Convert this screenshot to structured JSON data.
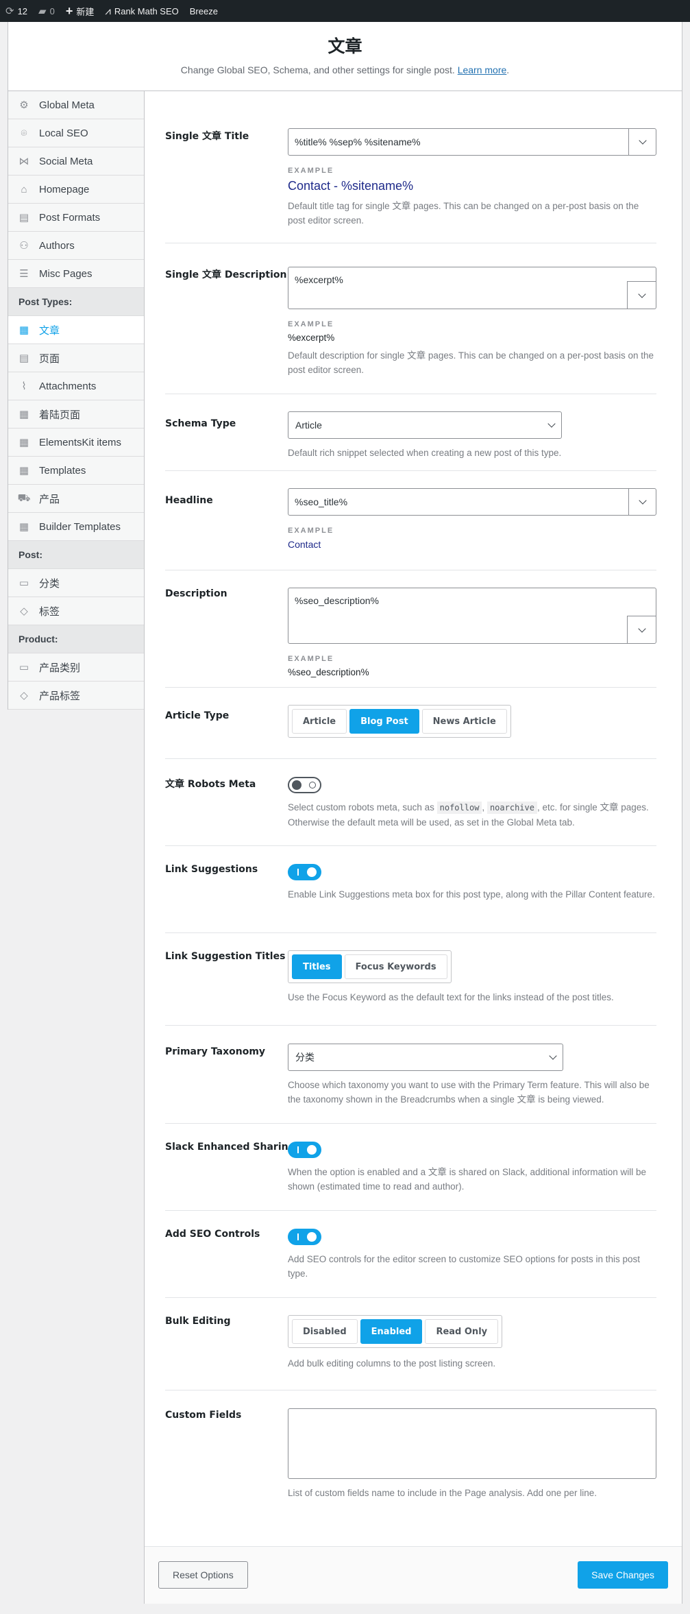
{
  "adminbar": {
    "items": [
      {
        "icon": "refresh-icon",
        "glyph": "⟳",
        "label": "12"
      },
      {
        "icon": "comment-icon",
        "glyph": "▰",
        "label": "0"
      },
      {
        "icon": "plus-icon",
        "glyph": "+",
        "label": "新建"
      },
      {
        "icon": "rankmath-icon",
        "glyph": "⩘",
        "label": "Rank Math SEO"
      },
      {
        "icon": "",
        "glyph": "",
        "label": "Breeze"
      }
    ]
  },
  "header": {
    "title": "文章",
    "subtitle": "Change Global SEO, Schema, and other settings for single post.",
    "learn_more": "Learn more"
  },
  "sidebar": {
    "items": [
      {
        "type": "item",
        "icon": "gear-icon",
        "glyph": "⚙",
        "label": "Global Meta"
      },
      {
        "type": "item",
        "icon": "location-pin-icon",
        "glyph": "⌾",
        "label": "Local SEO"
      },
      {
        "type": "item",
        "icon": "share-icon",
        "glyph": "⋈",
        "label": "Social Meta"
      },
      {
        "type": "item",
        "icon": "home-icon",
        "glyph": "⌂",
        "label": "Homepage"
      },
      {
        "type": "item",
        "icon": "document-icon",
        "glyph": "▤",
        "label": "Post Formats"
      },
      {
        "type": "item",
        "icon": "users-icon",
        "glyph": "⚇",
        "label": "Authors"
      },
      {
        "type": "item",
        "icon": "list-circle-icon",
        "glyph": "☰",
        "label": "Misc Pages"
      },
      {
        "type": "group",
        "label": "Post Types:"
      },
      {
        "type": "item",
        "icon": "post-icon",
        "glyph": "▦",
        "label": "文章",
        "active": true
      },
      {
        "type": "item",
        "icon": "page-icon",
        "glyph": "▤",
        "label": "页面"
      },
      {
        "type": "item",
        "icon": "paperclip-icon",
        "glyph": "⌇",
        "label": "Attachments"
      },
      {
        "type": "item",
        "icon": "post-icon",
        "glyph": "▦",
        "label": "着陆页面"
      },
      {
        "type": "item",
        "icon": "post-icon",
        "glyph": "▦",
        "label": "ElementsKit items"
      },
      {
        "type": "item",
        "icon": "post-icon",
        "glyph": "▦",
        "label": "Templates"
      },
      {
        "type": "item",
        "icon": "cart-icon",
        "glyph": "⛟",
        "label": "产品"
      },
      {
        "type": "item",
        "icon": "post-icon",
        "glyph": "▦",
        "label": "Builder Templates"
      },
      {
        "type": "group",
        "label": "Post:"
      },
      {
        "type": "item",
        "icon": "folder-icon",
        "glyph": "▭",
        "label": "分类"
      },
      {
        "type": "item",
        "icon": "tag-icon",
        "glyph": "◇",
        "label": "标签"
      },
      {
        "type": "group",
        "label": "Product:"
      },
      {
        "type": "item",
        "icon": "folder-icon",
        "glyph": "▭",
        "label": "产品类别"
      },
      {
        "type": "item",
        "icon": "tag-icon",
        "glyph": "◇",
        "label": "产品标签"
      }
    ]
  },
  "settings": {
    "example_label": "EXAMPLE",
    "single_title": {
      "label": "Single 文章 Title",
      "value": "%title% %sep% %sitename%",
      "example": "Contact - %sitename%",
      "desc": "Default title tag for single 文章 pages. This can be changed on a per-post basis on the post editor screen."
    },
    "single_description": {
      "label": "Single 文章 Description",
      "value": "%excerpt%",
      "example": "%excerpt%",
      "desc": "Default description for single 文章 pages. This can be changed on a per-post basis on the post editor screen."
    },
    "schema_type": {
      "label": "Schema Type",
      "value": "Article",
      "desc": "Default rich snippet selected when creating a new post of this type."
    },
    "headline": {
      "label": "Headline",
      "value": "%seo_title%",
      "example": "Contact"
    },
    "description": {
      "label": "Description",
      "value": "%seo_description%",
      "example": "%seo_description%"
    },
    "article_type": {
      "label": "Article Type",
      "options": [
        "Article",
        "Blog Post",
        "News Article"
      ],
      "selected": "Blog Post"
    },
    "robots_meta": {
      "label": "文章 Robots Meta",
      "enabled": false,
      "desc_before": "Select custom robots meta, such as",
      "code1": "nofollow",
      "sep": ",",
      "code2": "noarchive",
      "desc_after": ", etc. for single 文章 pages. Otherwise the default meta will be used, as set in the Global Meta tab."
    },
    "link_suggestions": {
      "label": "Link Suggestions",
      "enabled": true,
      "desc": "Enable Link Suggestions meta box for this post type, along with the Pillar Content feature."
    },
    "link_suggestion_titles": {
      "label": "Link Suggestion Titles",
      "options": [
        "Titles",
        "Focus Keywords"
      ],
      "selected": "Titles",
      "desc": "Use the Focus Keyword as the default text for the links instead of the post titles."
    },
    "primary_taxonomy": {
      "label": "Primary Taxonomy",
      "value": "分类",
      "desc": "Choose which taxonomy you want to use with the Primary Term feature. This will also be the taxonomy shown in the Breadcrumbs when a single 文章 is being viewed."
    },
    "slack_sharing": {
      "label": "Slack Enhanced Sharing",
      "enabled": true,
      "desc": "When the option is enabled and a 文章 is shared on Slack, additional information will be shown (estimated time to read and author)."
    },
    "seo_controls": {
      "label": "Add SEO Controls",
      "enabled": true,
      "desc": "Add SEO controls for the editor screen to customize SEO options for posts in this post type."
    },
    "bulk_editing": {
      "label": "Bulk Editing",
      "options": [
        "Disabled",
        "Enabled",
        "Read Only"
      ],
      "selected": "Enabled",
      "desc": "Add bulk editing columns to the post listing screen."
    },
    "custom_fields": {
      "label": "Custom Fields",
      "value": "",
      "desc": "List of custom fields name to include in the Page analysis. Add one per line."
    }
  },
  "footer": {
    "reset_label": "Reset Options",
    "save_label": "Save Changes"
  },
  "colors": {
    "accent": "#10a2e8",
    "adminbar": "#1d2327",
    "example_text": "#1e2a8a"
  }
}
